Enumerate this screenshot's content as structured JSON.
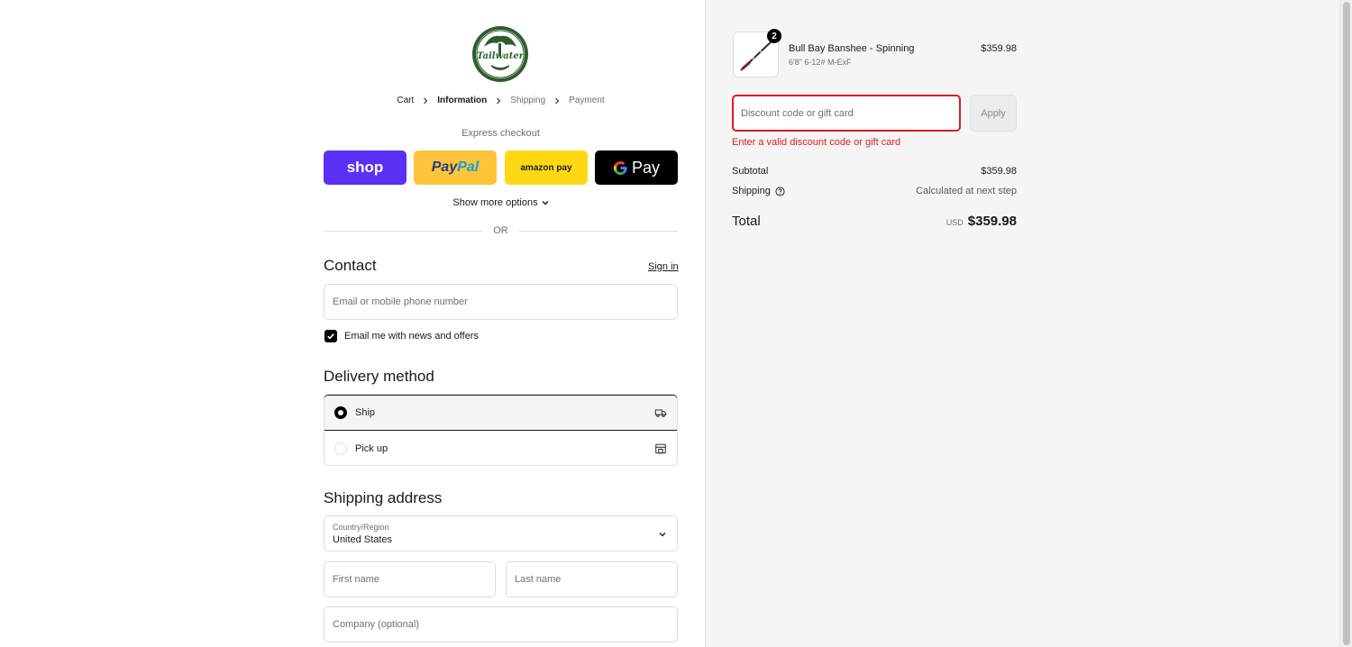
{
  "store": {
    "logo_text": "Tailwater"
  },
  "breadcrumb": {
    "items": [
      {
        "label": "Cart"
      },
      {
        "label": "Information"
      },
      {
        "label": "Shipping"
      },
      {
        "label": "Payment"
      }
    ]
  },
  "express": {
    "label": "Express checkout",
    "buttons": {
      "shop": "shop",
      "paypal_a": "Pay",
      "paypal_b": "Pal",
      "amazon": "amazon pay",
      "gpay": "Pay"
    },
    "more_options": "Show more options"
  },
  "divider": {
    "or": "OR"
  },
  "contact": {
    "heading": "Contact",
    "sign_in": "Sign in",
    "email_placeholder": "Email or mobile phone number",
    "newsletter_label": "Email me with news and offers",
    "newsletter_checked": true
  },
  "delivery": {
    "heading": "Delivery method",
    "options": [
      {
        "label": "Ship",
        "icon": "truck-icon",
        "selected": true
      },
      {
        "label": "Pick up",
        "icon": "store-icon",
        "selected": false
      }
    ]
  },
  "shipping_address": {
    "heading": "Shipping address",
    "country_label": "Country/Region",
    "country_value": "United States",
    "first_name_placeholder": "First name",
    "last_name_placeholder": "Last name",
    "company_placeholder": "Company (optional)"
  },
  "order": {
    "item": {
      "name": "Bull Bay Banshee - Spinning",
      "variant": "6'8\" 6-12# M-ExF",
      "price": "$359.98",
      "quantity": "2"
    },
    "discount": {
      "placeholder": "Discount code or gift card",
      "apply": "Apply",
      "error": "Enter a valid discount code or gift card"
    },
    "subtotal_label": "Subtotal",
    "subtotal_value": "$359.98",
    "shipping_label": "Shipping",
    "shipping_value": "Calculated at next step",
    "total_label": "Total",
    "total_currency": "USD",
    "total_value": "$359.98"
  },
  "colors": {
    "shop": "#5a31f4",
    "paypal": "#ffc439",
    "amazon": "#ffd814",
    "error": "#dd1d1d"
  }
}
